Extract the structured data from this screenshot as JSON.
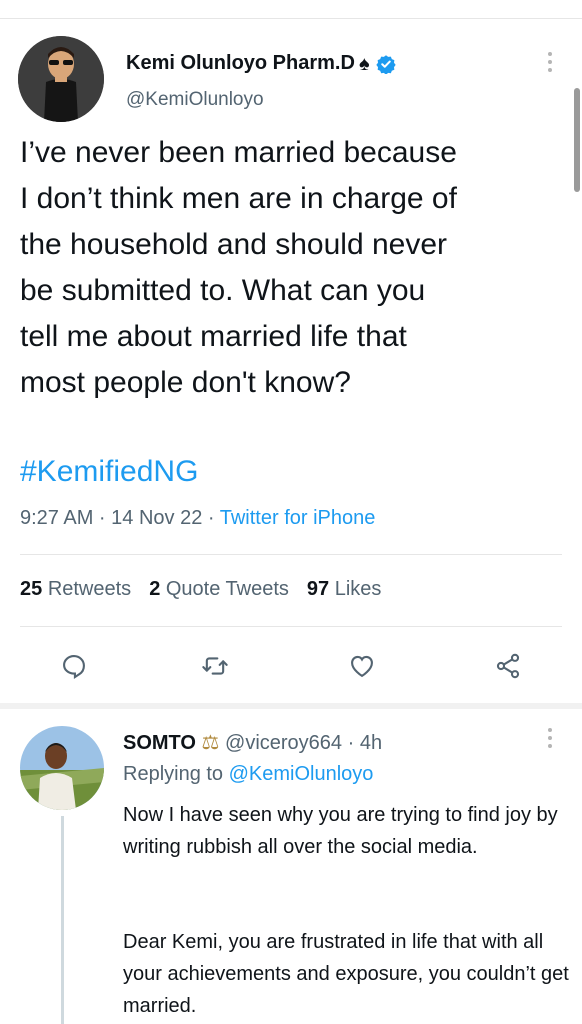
{
  "tweet": {
    "author_name": "Kemi Olunloyo Pharm.D",
    "author_emoji": "♠",
    "handle": "@KemiOlunloyo",
    "text": "I’ve never been married because\nI don’t think men are in charge of\nthe household and should never\nbe submitted to. What can you\ntell me about married life that\nmost people don't know?",
    "hashtag": "#KemifiedNG",
    "timestamp": "9:27 AM · 14 Nov 22 · ",
    "source": "Twitter for iPhone",
    "stats": {
      "retweets_count": "25",
      "retweets_label": "Retweets",
      "quotes_count": "2",
      "quotes_label": "Quote Tweets",
      "likes_count": "97",
      "likes_label": "Likes"
    }
  },
  "actions": {
    "icons": [
      "reply-icon",
      "retweet-icon",
      "like-icon",
      "share-icon"
    ]
  },
  "reply": {
    "name": "SOMTO",
    "emoji": "⚖",
    "handle": "@viceroy664",
    "dot": " · ",
    "time": "4h",
    "replying_prefix": "Replying to ",
    "replying_to": "@KemiOlunloyo",
    "text_1": "Now I have seen why you are trying to find joy by writing rubbish all over the social media.",
    "text_2": "Dear Kemi, you are frustrated in life that with all your achievements and exposure, you couldn’t get married."
  },
  "colors": {
    "accent": "#1d9bf0",
    "text": "#0f1419",
    "secondary": "#536471"
  }
}
